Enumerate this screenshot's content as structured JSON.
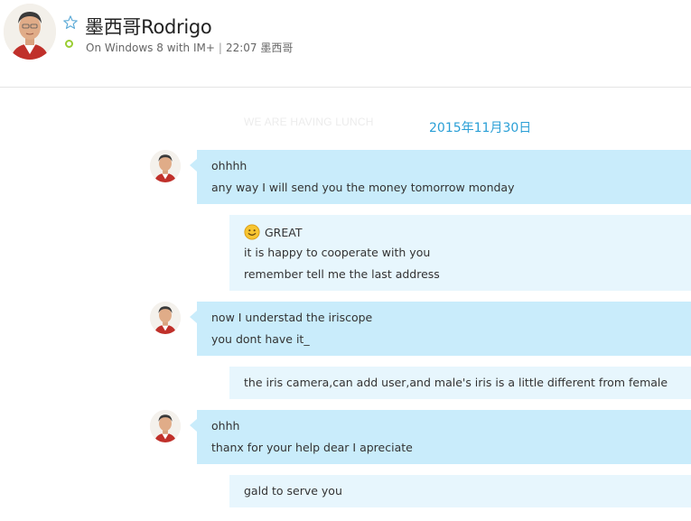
{
  "header": {
    "contact_name": "墨西哥Rodrigo",
    "platform": "On Windows 8 with IM+",
    "separator": "|",
    "last_seen": "22:07 墨西哥",
    "status": "online",
    "status_color": "#9acd32",
    "favorite_icon": "star-outline-icon"
  },
  "conversation": {
    "ghost_text": "WE ARE HAVING LUNCH",
    "date": "2015年11月30日",
    "messages": [
      {
        "direction": "in",
        "lines": [
          "ohhhh",
          "any way I will send you the money tomorrow monday"
        ]
      },
      {
        "direction": "out",
        "emoji": "smile-emoji-icon",
        "lines": [
          "GREAT",
          "it is happy to cooperate with you",
          "remember tell me  the last address"
        ]
      },
      {
        "direction": "in",
        "lines": [
          "now I understad the iriscope",
          "you dont have it_"
        ]
      },
      {
        "direction": "out",
        "lines": [
          "the iris camera,can add user,and male's iris is a little different from female"
        ]
      },
      {
        "direction": "in",
        "lines": [
          "ohhh",
          "thanx for your help dear I apreciate"
        ]
      },
      {
        "direction": "out",
        "lines": [
          "gald to serve you"
        ]
      }
    ]
  },
  "colors": {
    "incoming_bubble": "#c9ecfb",
    "outgoing_bubble": "#e7f6fd",
    "date_text": "#2a9fd6"
  }
}
